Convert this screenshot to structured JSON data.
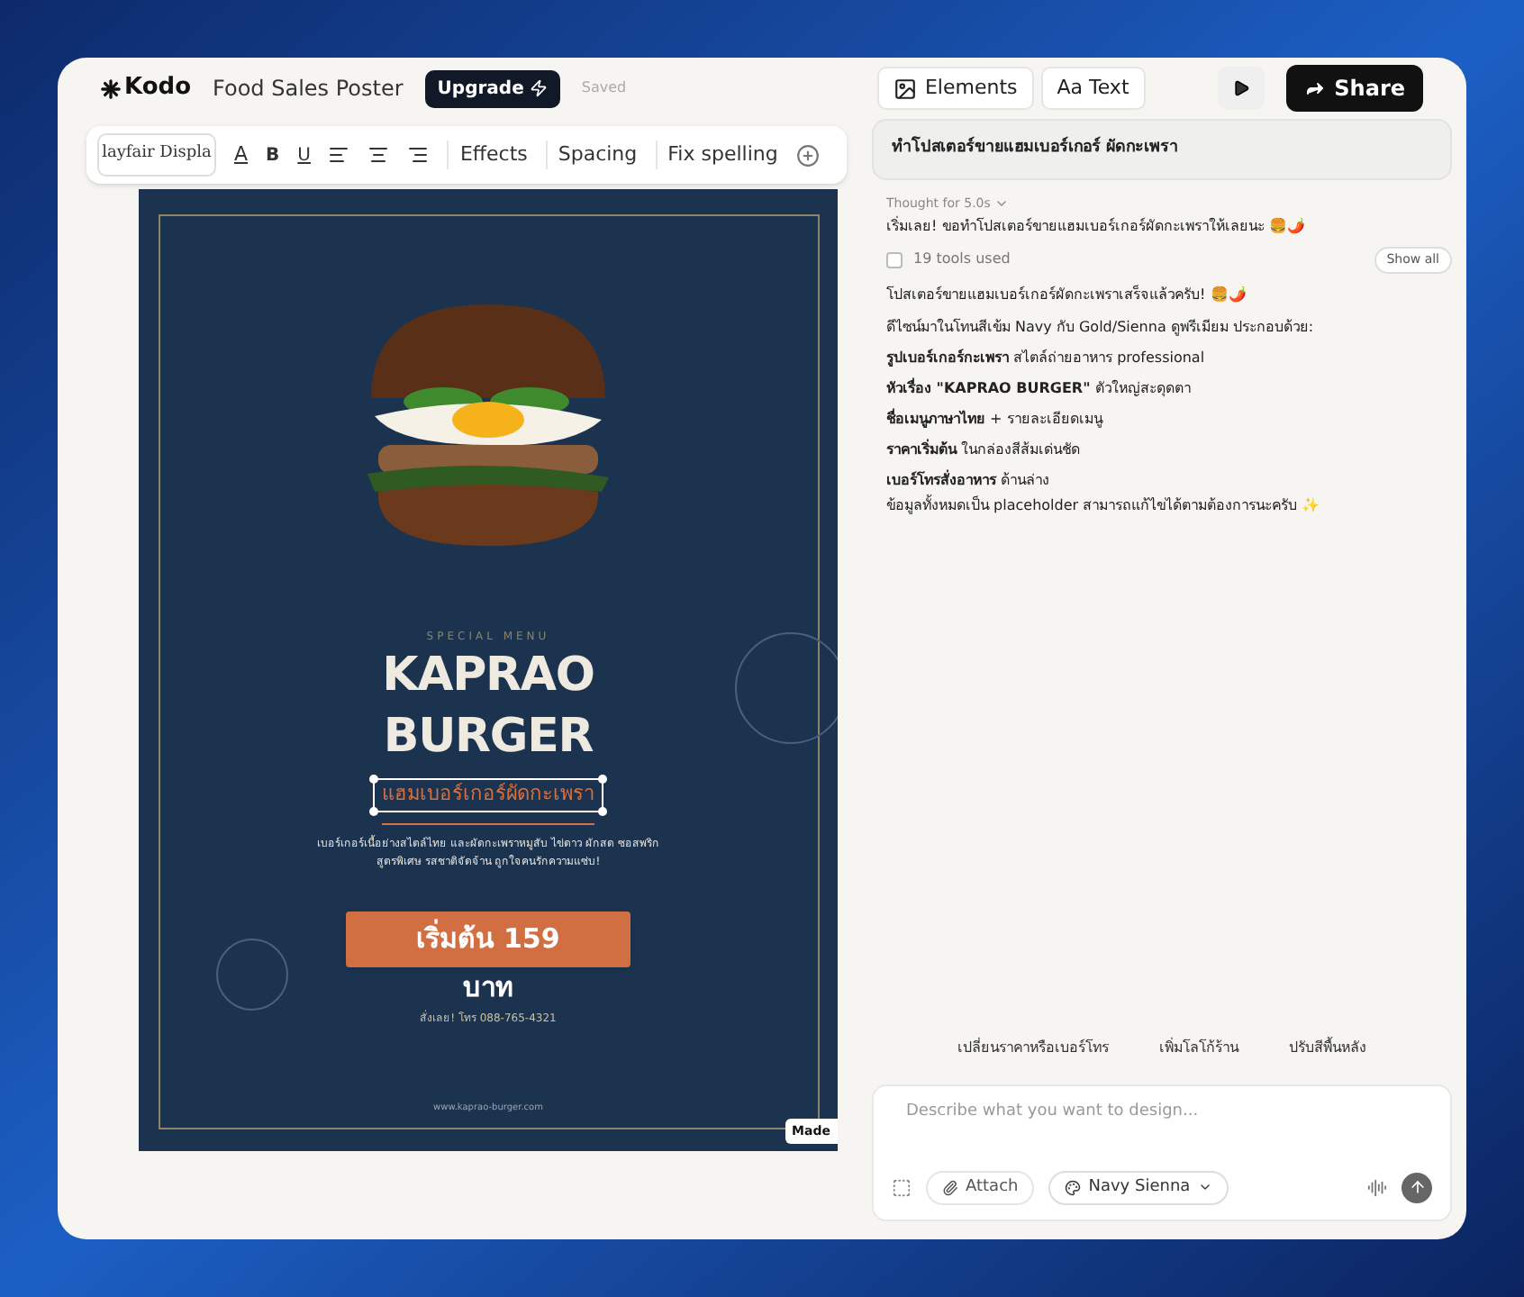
{
  "app": {
    "logo": "Kodo",
    "document_title": "Food Sales Poster",
    "upgrade_button": "Upgrade",
    "save_status": "Saved"
  },
  "header_tabs": [
    {
      "label": "Elements",
      "kind": "image"
    },
    {
      "label": "Aa Text",
      "kind": "plain"
    }
  ],
  "share_button": "Share",
  "toolbar": {
    "font": "layfair Displa",
    "color_button": "A",
    "bold_button": "B",
    "underline_button": "U",
    "actions": [
      "Effects",
      "Spacing",
      "Fix spelling"
    ]
  },
  "poster": {
    "eyebrow": "SPECIAL MENU",
    "title_lines": [
      "KAPRAO",
      "BURGER"
    ],
    "subtitle": {
      "text": "แฮมเบอร์เกอร์ผัดกะเพรา",
      "selected": true
    },
    "description": "เบอร์เกอร์เนื้อย่างสไตล์ไทย และผัดกะเพราหมูสับ ไข่ดาว ผักสด ซอสพริกสูตรพิเศษ รสชาติจัดจ้าน ถูกใจคนรักความแซ่บ!",
    "price": "เริ่มต้น 159",
    "price_unit": "บาท",
    "phone": "สั่งเลย! โทร 088-765-4321",
    "website": "www.kaprao-burger.com"
  },
  "made_badge": "Made",
  "chat": {
    "prompt": "ทำโปสเตอร์ขายแฮมเบอร์เกอร์ ผัดกะเพรา",
    "thought": "Thought for 5.0s",
    "intro": "เริ่มเลย! ขอทำโปสเตอร์ขายแฮมเบอร์เกอร์ผัดกะเพราให้เลยนะ 🍔🌶️",
    "tools": {
      "label": "19 tools used",
      "checked": false,
      "button": "Show all"
    },
    "paragraphs": [
      "โปสเตอร์ขายแฮมเบอร์เกอร์ผัดกะเพราเสร็จแล้วครับ! 🍔🌶️",
      "ดีไซน์มาในโทนสีเข้ม Navy กับ Gold/Sienna ดูพรีเมียม ประกอบด้วย:"
    ],
    "features": [
      "**รูปเบอร์เกอร์กะเพรา** สไตล์ถ่ายอาหาร professional",
      "**หัวเรื่อง \"KAPRAO BURGER\"** ตัวใหญ่สะดุดตา",
      "**ชื่อเมนูภาษาไทย** + รายละเอียดเมนู",
      "**ราคาเริ่มต้น** ในกล่องสีส้มเด่นชัด",
      "**เบอร์โทรสั่งอาหาร** ด้านล่าง"
    ],
    "closing": "ข้อมูลทั้งหมดเป็น placeholder สามารถแก้ไขได้ตามต้องการนะครับ ✨"
  },
  "suggestions": [
    "เปลี่ยนราคาหรือเบอร์โทร",
    "เพิ่มโลโก้ร้าน",
    "ปรับสีพื้นหลัง"
  ],
  "composer": {
    "placeholder": "Describe what you want to design...",
    "attach_button": "Attach",
    "theme_button": "Navy Sienna"
  }
}
